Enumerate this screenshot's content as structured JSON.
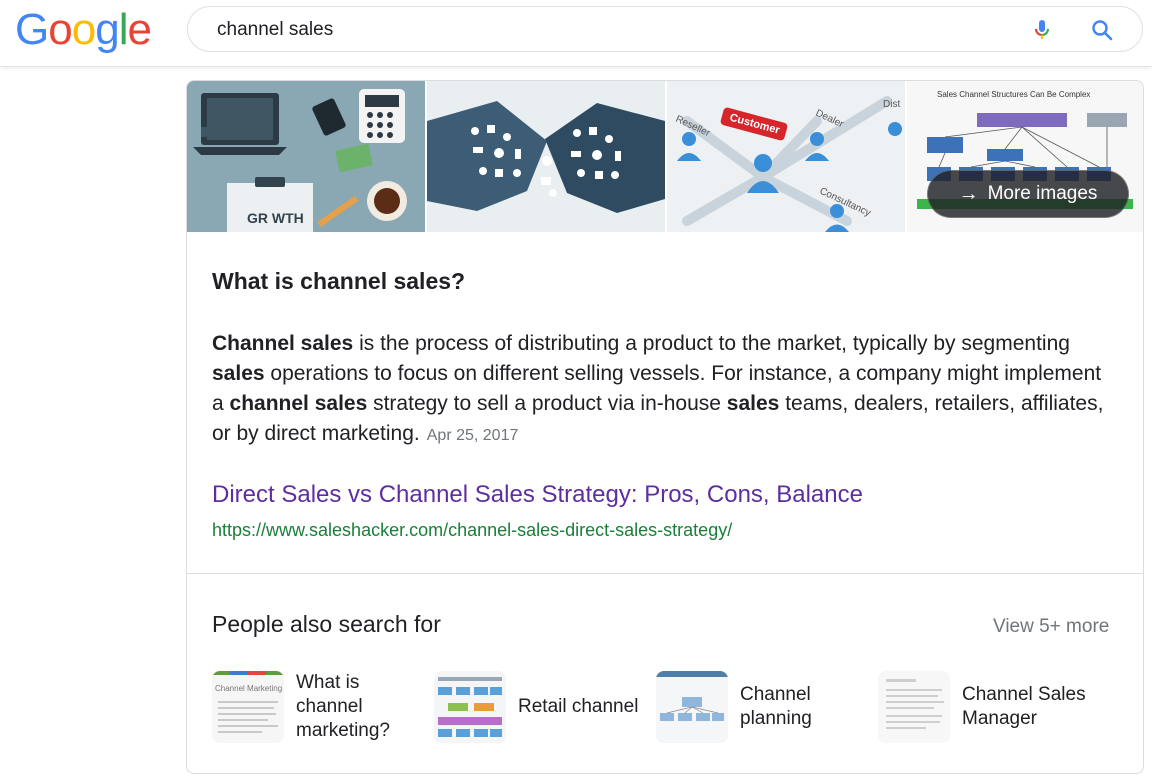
{
  "logo": {
    "letters": [
      "G",
      "o",
      "o",
      "g",
      "l",
      "e"
    ]
  },
  "search": {
    "query": "channel sales"
  },
  "images": {
    "more_images_label": "More images",
    "thumb_texts": {
      "growth": "GR WTH",
      "reseller": "Reseller",
      "customer": "Customer",
      "dealer": "Dealer",
      "dist": "Dist",
      "consultancy": "Consultancy",
      "chart_title": "Sales Channel Structures Can Be Complex"
    }
  },
  "answer": {
    "question": "What is channel sales?",
    "snippet_parts": [
      {
        "t": "Channel sales",
        "b": true
      },
      {
        "t": " is the process of distributing a product to the market, typically by segmenting ",
        "b": false
      },
      {
        "t": "sales",
        "b": true
      },
      {
        "t": " operations to focus on different selling vessels. For instance, a company might implement a ",
        "b": false
      },
      {
        "t": "channel sales",
        "b": true
      },
      {
        "t": " strategy to sell a product via in-house ",
        "b": false
      },
      {
        "t": "sales",
        "b": true
      },
      {
        "t": " teams, dealers, retailers, affiliates, or by direct marketing.",
        "b": false
      }
    ],
    "date": "Apr 25, 2017",
    "result_title": "Direct Sales vs Channel Sales Strategy: Pros, Cons, Balance",
    "result_url": "https://www.saleshacker.com/channel-sales-direct-sales-strategy/"
  },
  "people_also_search": {
    "title": "People also search for",
    "view_more": "View 5+ more",
    "items": [
      {
        "label_lines": [
          "What is",
          "channel",
          "marketing?"
        ],
        "thumb_text": "Channel Marketing"
      },
      {
        "label_lines": [
          "Retail channel"
        ]
      },
      {
        "label_lines": [
          "Channel",
          "planning"
        ]
      },
      {
        "label_lines": [
          "Channel Sales",
          "Manager"
        ]
      }
    ]
  },
  "colors": {
    "google_blue": "#4285F4",
    "google_red": "#EA4335",
    "google_yellow": "#FBBC05",
    "google_green": "#34A853",
    "link_visited": "#5e2ea0",
    "url_green": "#188038"
  }
}
